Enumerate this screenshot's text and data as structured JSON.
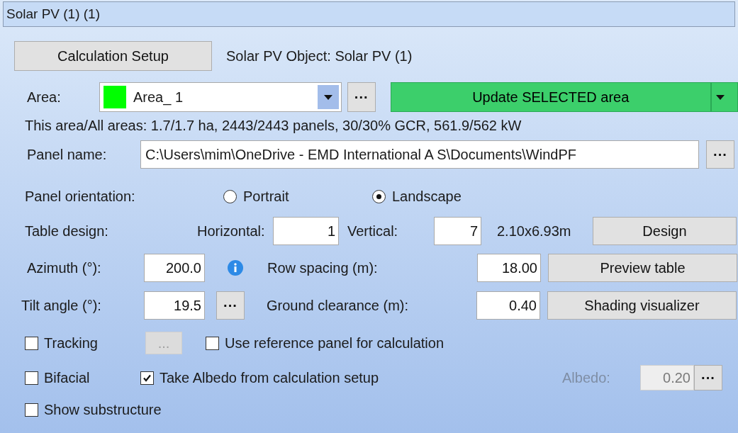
{
  "window": {
    "title": "Solar PV (1) (1)"
  },
  "calculation_setup_button": "Calculation Setup",
  "object_label": "Solar PV Object: Solar PV (1)",
  "area": {
    "label": "Area:",
    "value": "Area_ 1",
    "color": "#00ff00",
    "more_button": "···",
    "update_button": "Update SELECTED area"
  },
  "summary": "This area/All areas: 1.7/1.7 ha, 2443/2443 panels, 30/30% GCR, 561.9/562 kW",
  "panel_name": {
    "label": "Panel name:",
    "value": "C:\\Users\\mim\\OneDrive - EMD International A S\\Documents\\WindPF",
    "browse_button": "···"
  },
  "orientation": {
    "label": "Panel orientation:",
    "options": [
      {
        "label": "Portrait",
        "selected": false
      },
      {
        "label": "Landscape",
        "selected": true
      }
    ]
  },
  "table_design": {
    "label": "Table design:",
    "horizontal_label": "Horizontal:",
    "horizontal": "1",
    "vertical_label": "Vertical:",
    "vertical": "7",
    "size": "2.10x6.93m",
    "design_button": "Design"
  },
  "azimuth": {
    "label": "Azimuth (°):",
    "value": "200.0"
  },
  "row_spacing": {
    "label": "Row spacing (m):",
    "value": "18.00"
  },
  "preview_button": "Preview table",
  "tilt": {
    "label": "Tilt angle (°):",
    "value": "19.5",
    "button": "···"
  },
  "ground_clearance": {
    "label": "Ground clearance (m):",
    "value": "0.40"
  },
  "shading_button": "Shading visualizer",
  "tracking": {
    "label": "Tracking",
    "checked": false,
    "button": "...",
    "button_disabled": true
  },
  "use_reference": {
    "label": "Use reference panel for calculation",
    "checked": false
  },
  "bifacial": {
    "label": "Bifacial",
    "checked": false
  },
  "take_albedo": {
    "label": "Take Albedo from calculation setup",
    "checked": true
  },
  "albedo": {
    "label": "Albedo:",
    "value": "0.20",
    "disabled": true,
    "button": "···"
  },
  "show_substructure": {
    "label": "Show substructure",
    "checked": false
  }
}
